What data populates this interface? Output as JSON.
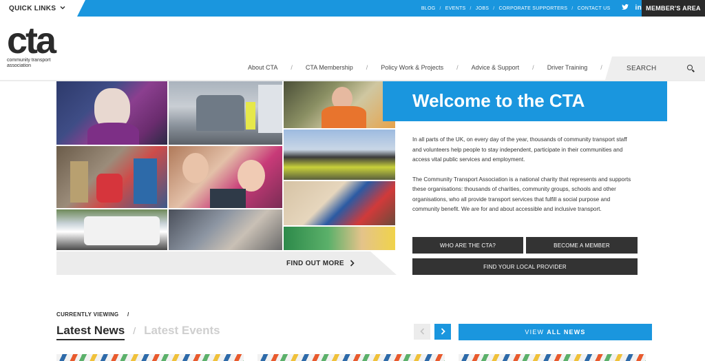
{
  "topbar": {
    "quick_links": "QUICK LINKS",
    "links": [
      "BLOG",
      "EVENTS",
      "JOBS",
      "CORPORATE SUPPORTERS",
      "CONTACT US"
    ],
    "social_icons": [
      "twitter-icon",
      "linkedin-icon"
    ],
    "social_glyphs": [
      "✦",
      "in"
    ],
    "member_area": "MEMBER'S AREA"
  },
  "logo": {
    "mark": "cta",
    "line1": "community transport",
    "line2": "association"
  },
  "nav": {
    "items": [
      "About CTA",
      "CTA Membership",
      "Policy Work & Projects",
      "Advice & Support",
      "Driver Training"
    ],
    "search_label": "SEARCH"
  },
  "hero": {
    "find_out_more": "FIND OUT MORE",
    "title": "Welcome to the CTA",
    "paragraphs": [
      "In all parts of the UK, on every day of the year, thousands of community transport staff and volunteers help people to stay independent, participate in their communities and access vital public services and employment.",
      "The Community Transport Association is a national charity that represents and supports these organisations: thousands of charities, community groups, schools and other organisations, who all provide transport services that fulfill a social purpose and community benefit. We are for and about accessible and inclusive transport."
    ],
    "buttons": {
      "who": "WHO ARE THE CTA?",
      "become": "BECOME A MEMBER",
      "find": "FIND YOUR LOCAL PROVIDER"
    }
  },
  "news": {
    "currently_viewing": "CURRENTLY VIEWING",
    "slash": "/",
    "tab_active": "Latest News",
    "tab_inactive": "Latest Events",
    "view": "VIEW",
    "all_news": "ALL NEWS"
  },
  "colors": {
    "accent": "#1a96de",
    "dark": "#333333",
    "light": "#ececec"
  }
}
